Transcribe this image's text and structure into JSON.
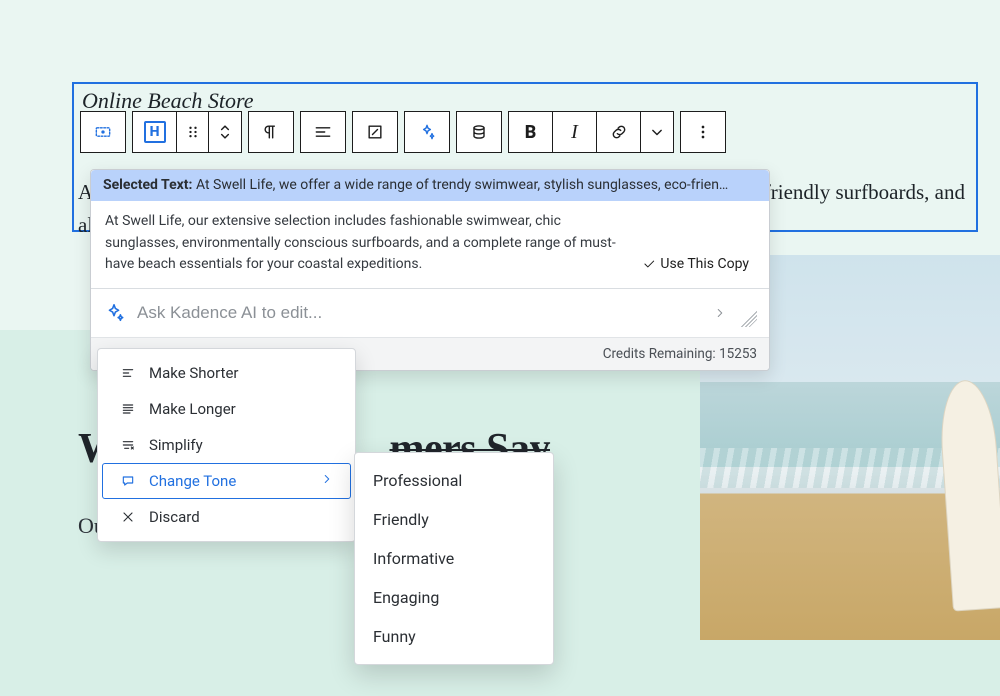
{
  "block": {
    "title": "Online Beach Store",
    "body": "At Swell Life, we offer a wide range of trendy swimwear, stylish sunglasses, eco-friendly surfboards, and all the beach essentials you need for your coastal adventures."
  },
  "background": {
    "heading_prefix": "W",
    "heading_struck": "mers Say",
    "sub": "Ou                                                                                     al-inspired accessories from Swell I"
  },
  "toolbar": {
    "block_type_letter": "H",
    "buttons": {
      "select_parent": "select-parent",
      "heading": "heading",
      "drag": "drag-handle",
      "move": "move-up-down",
      "paragraph": "paragraph",
      "align": "align",
      "aspect": "aspect-ratio",
      "ai": "ai-sparkle",
      "data": "data-source",
      "bold": "B",
      "italic": "I",
      "link": "link",
      "more_inline": "chevron-down",
      "options": "more-options"
    }
  },
  "ai": {
    "selected_label": "Selected Text:",
    "selected_text": "At Swell Life, we offer a wide range of trendy swimwear, stylish sunglasses, eco-frien…",
    "suggestion": "At Swell Life, our extensive selection includes fashionable swimwear, chic sunglasses, environmentally conscious surfboards, and a complete range of must-have beach essentials for your coastal expeditions.",
    "use_this": "Use This Copy",
    "placeholder": "Ask Kadence AI to edit...",
    "credits_label": "Credits Remaining:",
    "credits_value": "15253"
  },
  "actions": {
    "items": [
      {
        "id": "make-shorter",
        "label": "Make Shorter",
        "icon": "lines-narrow"
      },
      {
        "id": "make-longer",
        "label": "Make Longer",
        "icon": "lines-wide"
      },
      {
        "id": "simplify",
        "label": "Simplify",
        "icon": "simplify"
      },
      {
        "id": "change-tone",
        "label": "Change Tone",
        "icon": "chat",
        "submenu": true,
        "active": true
      },
      {
        "id": "discard",
        "label": "Discard",
        "icon": "x"
      }
    ]
  },
  "tones": [
    "Professional",
    "Friendly",
    "Informative",
    "Engaging",
    "Funny"
  ]
}
